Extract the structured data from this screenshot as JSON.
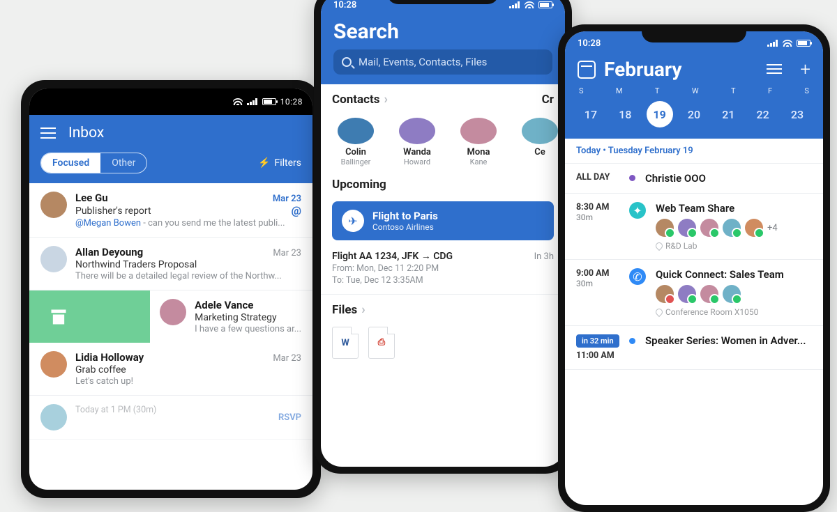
{
  "phone1": {
    "status_time": "10:28",
    "title": "Inbox",
    "segments": {
      "focused": "Focused",
      "other": "Other"
    },
    "filters_label": "Filters",
    "messages": [
      {
        "sender": "Lee Gu",
        "date": "Mar 23",
        "subject": "Publisher's report",
        "mention": "@Megan Bowen",
        "preview": " - can you send me the latest publi..."
      },
      {
        "sender": "Allan Deyoung",
        "date": "Mar 23",
        "subject": "Northwind Traders Proposal",
        "preview": "There will be a detailed legal review of the Northw..."
      },
      {
        "sender": "Adele Vance",
        "subject": "Marketing Strategy",
        "preview": "I have a few questions ar..."
      },
      {
        "sender": "Lidia Holloway",
        "date": "Mar 23",
        "subject": "Grab coffee",
        "preview": "Let's catch up!"
      }
    ],
    "rsvp_label": "RSVP",
    "rsvp_time": "Today at 1 PM (30m)"
  },
  "phone2": {
    "status_time": "10:28",
    "title": "Search",
    "search_placeholder": "Mail, Events, Contacts, Files",
    "section_contacts": "Contacts",
    "section_contacts_right": "Cr",
    "contacts": [
      {
        "first": "Colin",
        "last": "Ballinger"
      },
      {
        "first": "Wanda",
        "last": "Howard"
      },
      {
        "first": "Mona",
        "last": "Kane"
      },
      {
        "first": "Ce",
        "last": ""
      }
    ],
    "section_upcoming": "Upcoming",
    "upcoming_card": {
      "title": "Flight to Paris",
      "sub": "Contoso Airlines"
    },
    "flight": {
      "title": "Flight AA 1234, JFK → CDG",
      "in": "In 3h",
      "from": "From: Mon, Dec 11 2:20 PM",
      "to": "To: Tue, Dec 12 3:35AM"
    },
    "section_files": "Files",
    "files": {
      "word": "W",
      "pdf_glyph": "⬇"
    }
  },
  "phone3": {
    "status_time": "10:28",
    "title": "February",
    "dow": [
      "S",
      "M",
      "T",
      "W",
      "T",
      "F",
      "S"
    ],
    "days": [
      "17",
      "18",
      "19",
      "20",
      "21",
      "22",
      "23"
    ],
    "selected_day": "19",
    "today_label": "Today • Tuesday February 19",
    "allday_label": "ALL DAY",
    "allday_event": "Christie OOO",
    "events": [
      {
        "time": "8:30 AM",
        "dur": "30m",
        "title": "Web Team Share",
        "loc": "R&D Lab",
        "plus": "+4"
      },
      {
        "time": "9:00 AM",
        "dur": "30m",
        "title": "Quick Connect: Sales Team",
        "loc": "Conference Room X1050"
      },
      {
        "pill": "in 32 min",
        "time": "11:00 AM",
        "title": "Speaker Series: Women in Adver..."
      }
    ]
  },
  "avatar_colors": [
    "#b58863",
    "#673ab7",
    "#c48b9f",
    "#3e7cb1",
    "#3e7cb1",
    "#c48b9f",
    "#b58863",
    "#8e7cc3",
    "#d08c60",
    "#6fb1c7"
  ]
}
